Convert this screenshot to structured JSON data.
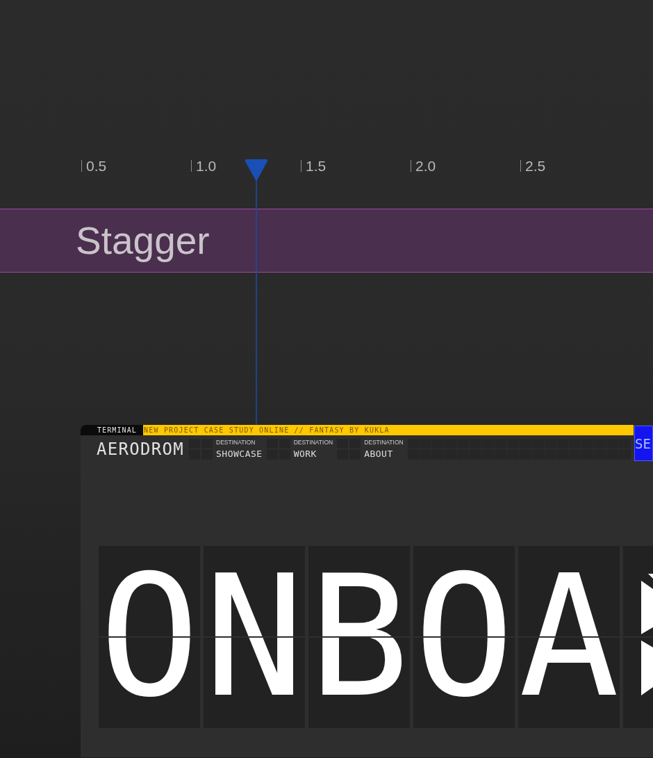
{
  "timeline": {
    "ruler": [
      "0.5",
      "1.0",
      "1.5",
      "2.0",
      "2.5"
    ],
    "playhead": {
      "level": 0.3926
    },
    "clips": [
      {
        "label": "Stagger"
      }
    ]
  },
  "terminal": {
    "label": "TERMINAL",
    "ticker": "NEW PROJECT CASE STUDY ONLINE // FANTASY BY KUKLA",
    "brand": "AERODROM",
    "destinations": [
      {
        "caption": "DESTINATION",
        "value": "SHOWCASE"
      },
      {
        "caption": "DESTINATION",
        "value": "WORK"
      },
      {
        "caption": "DESTINATION",
        "value": "ABOUT"
      }
    ],
    "display": "SE",
    "board": [
      "O",
      "N",
      "B",
      "O",
      "A"
    ]
  }
}
